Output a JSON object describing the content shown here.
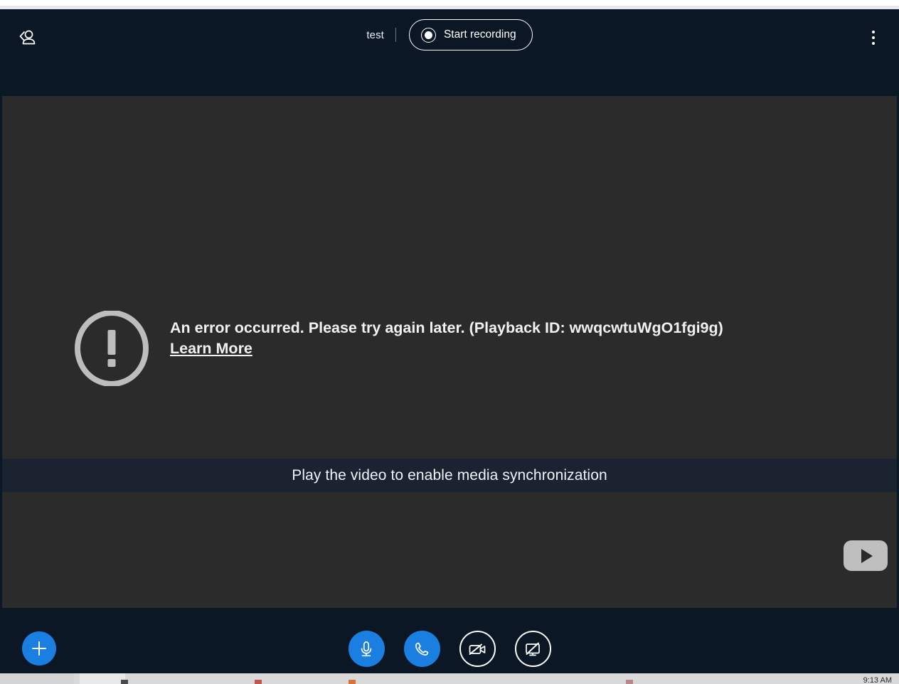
{
  "window": {
    "background_color": "#0b1725",
    "stage_color": "#2b2b2b",
    "accent_color": "#1a7fe0"
  },
  "header": {
    "invite_icon": "add-person-icon",
    "meeting_name": "test",
    "record_button": {
      "label": "Start recording",
      "icon": "record-dot-icon"
    },
    "more_icon": "more-vertical-icon"
  },
  "stage": {
    "error": {
      "icon": "alert-circle-icon",
      "message": "An error occurred. Please try again later. (Playback ID: wwqcwtuWgO1fgi9g)",
      "link_label": "Learn More"
    },
    "sync_banner": {
      "text": "Play the video to enable media synchronization",
      "background_color": "#1b2230"
    },
    "lower_player": {
      "play_icon": "youtube-play-icon"
    }
  },
  "controls": {
    "add_button": {
      "icon": "plus-icon",
      "label": ""
    },
    "buttons": [
      {
        "name": "microphone",
        "icon": "microphone-icon",
        "style": "filled"
      },
      {
        "name": "phone",
        "icon": "phone-icon",
        "style": "filled"
      },
      {
        "name": "camera-off",
        "icon": "video-off-icon",
        "style": "outlined"
      },
      {
        "name": "screenshare-off",
        "icon": "screen-share-off-icon",
        "style": "outlined"
      }
    ]
  },
  "taskbar": {
    "clock": "9:13 AM"
  }
}
